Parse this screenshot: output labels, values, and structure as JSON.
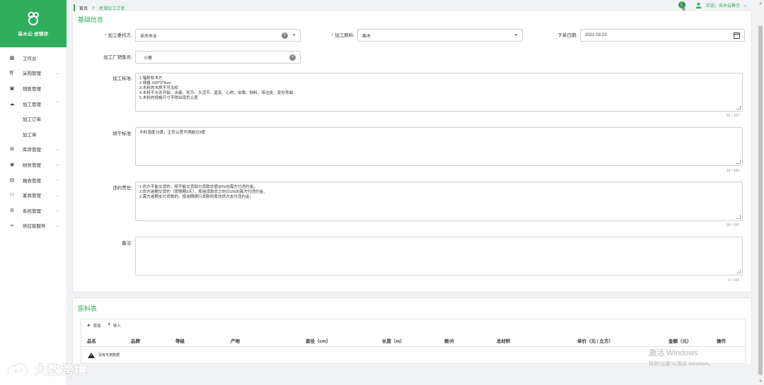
{
  "brand": {
    "name": "采木云·进销存"
  },
  "sidebar": {
    "items": [
      {
        "label": "工作台",
        "icon": "dashboard-icon",
        "chevron": ""
      },
      {
        "label": "采购管理",
        "icon": "cart-icon",
        "chevron": "⌄"
      },
      {
        "label": "销售管理",
        "icon": "sales-icon",
        "chevron": ""
      },
      {
        "label": "加工管理",
        "icon": "cloud-icon",
        "chevron": "⌃"
      },
      {
        "label": "加工订单",
        "icon": "",
        "chevron": ""
      },
      {
        "label": "加工单",
        "icon": "",
        "chevron": ""
      },
      {
        "label": "库存管理",
        "icon": "warehouse-icon",
        "chevron": "⌄"
      },
      {
        "label": "财务管理",
        "icon": "finance-icon",
        "chevron": "⌄"
      },
      {
        "label": "报表管理",
        "icon": "report-icon",
        "chevron": "⌄"
      },
      {
        "label": "客商管理",
        "icon": "customers-icon",
        "chevron": "⌄"
      },
      {
        "label": "系统管理",
        "icon": "settings-icon",
        "chevron": "⌄"
      },
      {
        "label": "供应链服务",
        "icon": "link-icon",
        "chevron": "⌄"
      }
    ]
  },
  "header": {
    "breadcrumb_home": "首页",
    "breadcrumb_sep": ">",
    "breadcrumb_current": "新增加工订单",
    "mini_app_label": "小程序",
    "welcome": "欢迎，采木云售示"
  },
  "basic": {
    "section_title": "基础信息",
    "client_label": "加工委托方:",
    "client_value": "采木木业",
    "material_label": "加工原料:",
    "material_value": "果木",
    "date_label": "下单日期:",
    "date_value": "2021-03-23",
    "sales_label": "加工厂销售员:",
    "sales_value": "小蔡",
    "standard_label": "加工标准:",
    "standard_lines": [
      "1.辐射松木方",
      "2.规格 200*3*4cm",
      "3.木料的木质不可太松",
      "4.木料不允许开裂、水痕、死节、大活节、蓝变、心材、虫眼、斜料、带边皮、变形弯曲",
      "5.木料的规格尺寸不得出现负公差"
    ],
    "standard_count": "93 / 100",
    "drying_label": "烘干标准:",
    "drying_lines": [
      "木料湿度15度，正负公差不得超过3度"
    ],
    "drying_count": "18 / 100",
    "breach_label": "违约责任:",
    "breach_lines": [
      "1.供方不能交货的，按不能交货部分货款总值30%向需方付违约金。",
      "2.供方逾期交货的（宽限期5天），按逾货款总之的日1%向需方付违约金。",
      "3.需方逾期支付货款的，按逾期银行货款利率向供方支付违约金。"
    ],
    "breach_count": "99 / 100",
    "remark_label": "备注:",
    "remark_count": "0 / 100"
  },
  "materials": {
    "section_title": "原料表",
    "add_label": "添加",
    "import_label": "导入",
    "columns": [
      "品名",
      "品牌",
      "等级",
      "产地",
      "直径（cm）",
      "长度（m）",
      "根/片",
      "总材积",
      "单价（元 / 立方）",
      "金额（元）",
      "操作"
    ],
    "empty_text": "没有可用数据"
  },
  "watermark": {
    "win_title": "激活 Windows",
    "win_sub": "转到\"设置\"以激活 Windows。",
    "brand_text": "大数跨境"
  },
  "colors": {
    "accent": "#2fae5c",
    "required": "#e53935"
  }
}
